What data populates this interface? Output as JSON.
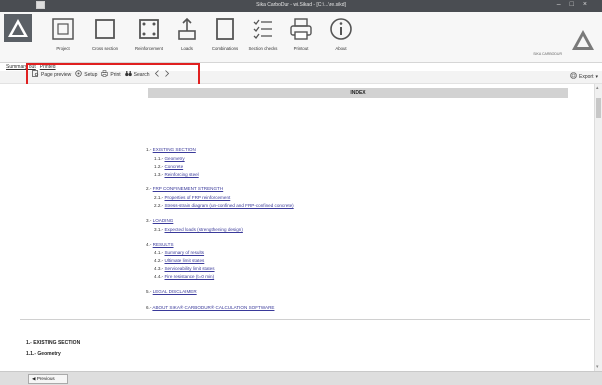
{
  "window": {
    "title": "Sika CarboDur - wi.Sikad - [C:\\...\\re.sikd]",
    "controls": [
      "–",
      "□",
      "×"
    ]
  },
  "ribbon": {
    "buttons": [
      {
        "label": "Project",
        "icon": "project-icon"
      },
      {
        "label": "Cross section",
        "icon": "cross-section-icon"
      },
      {
        "label": "Reinforcement",
        "icon": "reinforcement-icon"
      },
      {
        "label": "Loads",
        "icon": "loads-icon"
      },
      {
        "label": "Combinations",
        "icon": "combinations-icon"
      },
      {
        "label": "Section checks",
        "icon": "section-checks-icon"
      },
      {
        "label": "Printout",
        "icon": "printer-icon"
      },
      {
        "label": "About",
        "icon": "info-icon"
      }
    ],
    "right_text": "SIKA CARBODUR"
  },
  "breadcrumb": [
    "Summary out",
    "Printed"
  ],
  "toolbar": {
    "page_preview": "Page preview",
    "setup": "Setup",
    "print": "Print",
    "search": "Search",
    "export": "Export"
  },
  "index": {
    "header": "INDEX",
    "items": [
      {
        "num": "1.-",
        "text": "EXISTING SECTION"
      },
      {
        "num": "1.1.-",
        "text": "Geometry"
      },
      {
        "num": "1.2.-",
        "text": "Concrete"
      },
      {
        "num": "1.3.-",
        "text": "Reinforcing steel"
      },
      {
        "num": "2.-",
        "text": "FRP CONFINEMENT STRENGTH"
      },
      {
        "num": "2.1.-",
        "text": "Properties of FRP reinforcement"
      },
      {
        "num": "2.2.-",
        "text": "Stress-strain diagram (un-confined and FRP-confined concrete)"
      },
      {
        "num": "3.-",
        "text": "LOADING"
      },
      {
        "num": "3.1.-",
        "text": "Expected loads (strengthening design)"
      },
      {
        "num": "4.-",
        "text": "RESULTS"
      },
      {
        "num": "4.1.-",
        "text": "Summary of results"
      },
      {
        "num": "4.2.-",
        "text": "Ultimate limit states"
      },
      {
        "num": "4.3.-",
        "text": "Serviceability limit states"
      },
      {
        "num": "4.4.-",
        "text": "Fire resistance (t=0 min)"
      },
      {
        "num": "5.-",
        "text": "LEGAL DISCLAIMER"
      },
      {
        "num": "6.-",
        "text": "ABOUT SIKA® CARBODUR® CALCULATION SOFTWARE"
      }
    ]
  },
  "section": {
    "title": "1.- EXISTING SECTION",
    "subtitle": "1.1.- Geometry"
  },
  "status": {
    "previous": "Previous"
  },
  "colors": {
    "highlight": "#e02020",
    "link": "#3a3a9a",
    "titlebar": "#4a4d52"
  }
}
